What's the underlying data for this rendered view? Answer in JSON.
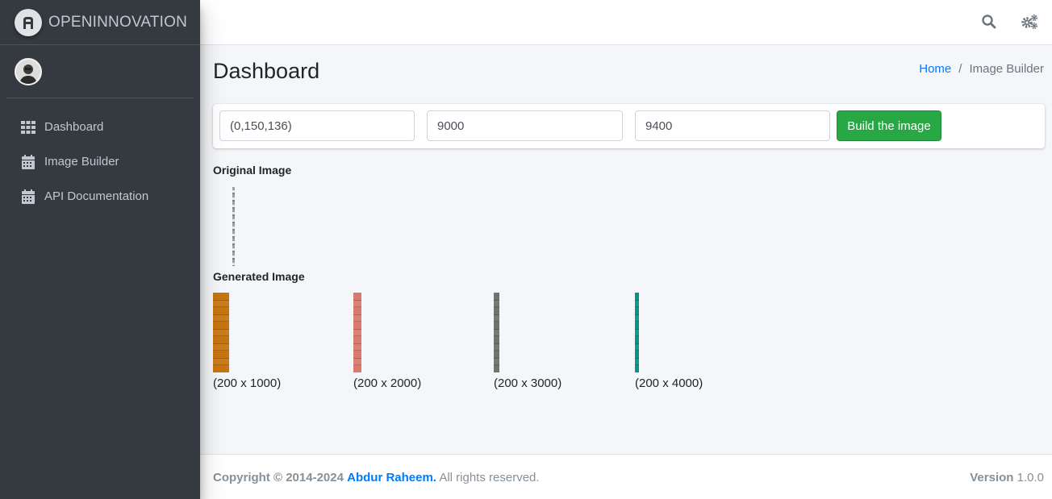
{
  "brand": {
    "name": "OPENINNOVATION",
    "logo_icon": "brand-logo-icon"
  },
  "sidebar": {
    "items": [
      {
        "label": "Dashboard",
        "icon": "grid-icon"
      },
      {
        "label": "Image Builder",
        "icon": "calendar-icon"
      },
      {
        "label": "API Documentation",
        "icon": "calendar-icon"
      }
    ]
  },
  "topbar": {
    "search_icon": "search-icon",
    "settings_icon": "gears-icon"
  },
  "page": {
    "title": "Dashboard",
    "breadcrumb": {
      "home": "Home",
      "separator": "/",
      "current": "Image Builder"
    }
  },
  "form": {
    "color_value": "(0,150,136)",
    "field2_value": "9000",
    "field3_value": "9400",
    "build_label": "Build the image"
  },
  "original": {
    "label": "Original Image"
  },
  "generated": {
    "label": "Generated Image",
    "items": [
      {
        "caption": "(200 x 1000)",
        "color": "#c8740f"
      },
      {
        "caption": "(200 x 2000)",
        "color": "#d97a6c"
      },
      {
        "caption": "(200 x 3000)",
        "color": "#6f726d"
      },
      {
        "caption": "(200 x 4000)",
        "color": "#009688"
      }
    ]
  },
  "footer": {
    "copyright": "Copyright © 2014-2024",
    "author": "Abdur Raheem.",
    "rights": "All rights reserved.",
    "version_label": "Version",
    "version_value": "1.0.0"
  },
  "colors": {
    "sidebar": "#343a40",
    "accent": "#007bff",
    "success": "#28a745"
  }
}
